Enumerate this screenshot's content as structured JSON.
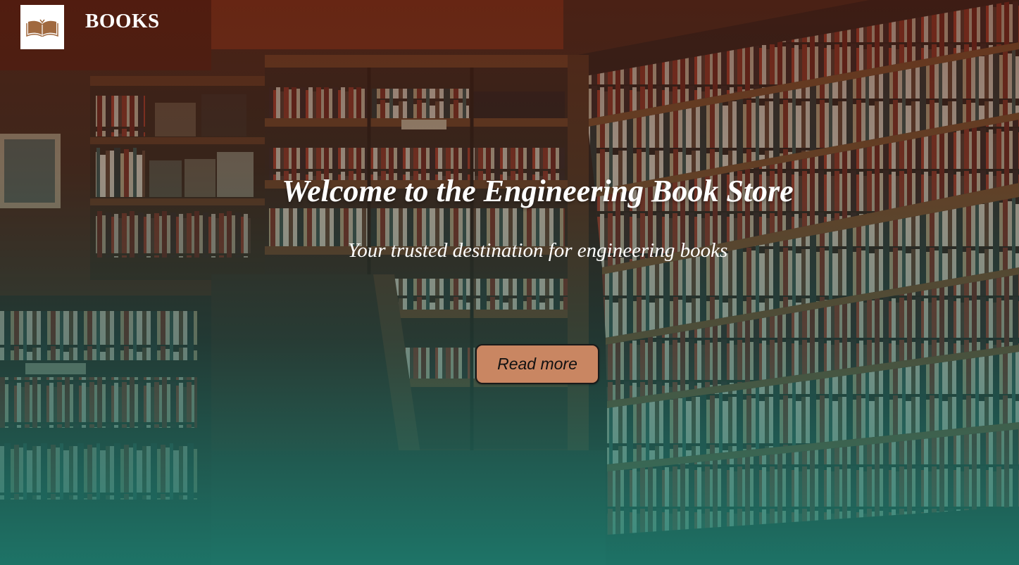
{
  "header": {
    "brand_name": "BOOKS",
    "logo_icon": "open-book-icon"
  },
  "hero": {
    "title": "Welcome to the Engineering Book Store",
    "subtitle": "Your trusted destination for engineering books",
    "cta_label": "Read more",
    "background": "library-bookshelves-photo"
  },
  "colors": {
    "overlay_top": "#4a160a",
    "overlay_bottom": "#1a8072",
    "button_fill": "#c98662",
    "logo_icon": "#a0693f",
    "text": "#ffffff"
  }
}
